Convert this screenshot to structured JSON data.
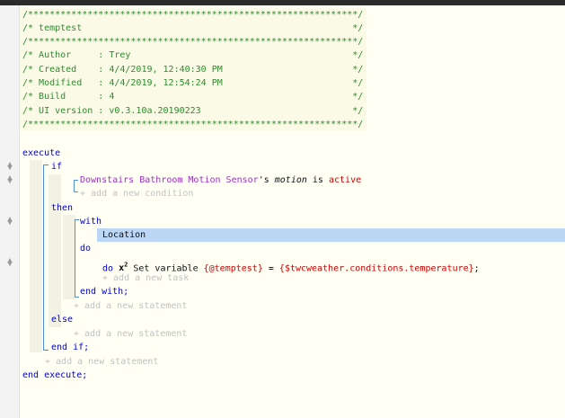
{
  "header": {
    "rule_top": "/*************************************************************/",
    "rule_mid": "/*************************************************************/",
    "rule_bot": "/*************************************************************/",
    "name_line": "/* temptest                                                  */",
    "author_line": "/* Author     : Trey                                         */",
    "created_line": "/* Created    : 4/4/2019, 12:40:30 PM                        */",
    "modified_line": "/* Modified   : 4/4/2019, 12:54:24 PM                        */",
    "build_line": "/* Build      : 4                                            */",
    "ui_line": "/* UI version : v0.3.10a.20190223                            */"
  },
  "code": {
    "execute": "execute",
    "if": "if",
    "device": "Downstairs Bathroom Motion Sensor",
    "possessive": "'s",
    "attribute": "motion",
    "is": " is ",
    "state": "active",
    "add_condition": "+ add a new condition",
    "then": "then",
    "with": "with",
    "location": "Location",
    "do": "do",
    "do2": "do",
    "operator_icon": "x",
    "operator_power": "2",
    "set_variable": " Set variable ",
    "var_name": "{@temptest}",
    "equals": " = ",
    "expression": "{$twcweather.conditions.temperature}",
    "semicolon": ";",
    "add_task": "+ add a new task",
    "end_with": "end with;",
    "add_statement_1": "+ add a new statement",
    "else": "else",
    "add_statement_2": "+ add a new statement",
    "end_if": "end if;",
    "add_statement_3": "+ add a new statement",
    "end_execute": "end execute;"
  },
  "icons": {
    "drag_handle": "up-down-arrows"
  }
}
